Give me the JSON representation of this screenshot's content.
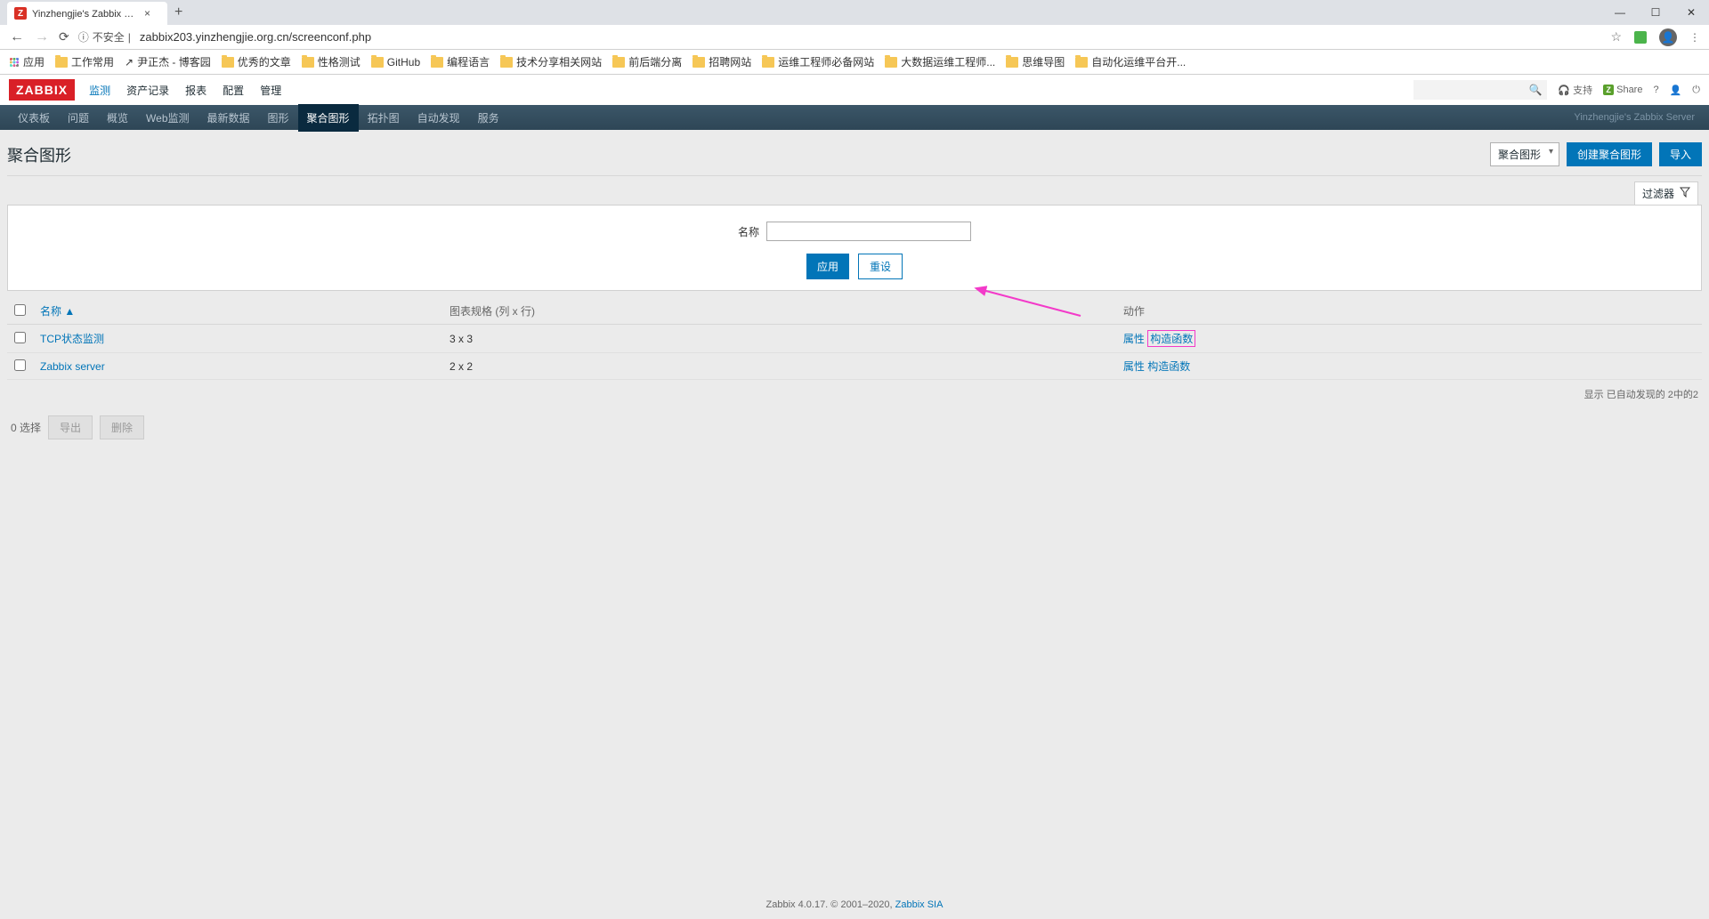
{
  "browser": {
    "tab_title": "Yinzhengjie's Zabbix Server: 聚",
    "favicon_letter": "Z",
    "url_security": "不安全",
    "url": "zabbix203.yinzhengjie.org.cn/screenconf.php"
  },
  "bookmarks": {
    "apps": "应用",
    "items": [
      "工作常用",
      "尹正杰 - 博客园",
      "优秀的文章",
      "性格测试",
      "GitHub",
      "编程语言",
      "技术分享相关网站",
      "前后端分离",
      "招聘网站",
      "运维工程师必备网站",
      "大数据运维工程师...",
      "思维导图",
      "自动化运维平台开..."
    ]
  },
  "zbx_top_menu": [
    "监测",
    "资产记录",
    "报表",
    "配置",
    "管理"
  ],
  "zbx_logo": "ZABBIX",
  "hdr_support": "支持",
  "hdr_share": "Share",
  "submenu": [
    "仪表板",
    "问题",
    "概览",
    "Web监测",
    "最新数据",
    "图形",
    "聚合图形",
    "拓扑图",
    "自动发现",
    "服务"
  ],
  "submenu_right": "Yinzhengjie's Zabbix Server",
  "page_title": "聚合图形",
  "title_select": "聚合图形",
  "btn_create": "创建聚合图形",
  "btn_import": "导入",
  "filter_tab": "过滤器",
  "filter": {
    "name_label": "名称",
    "apply": "应用",
    "reset": "重设"
  },
  "table": {
    "headers": {
      "name": "名称 ▲",
      "dim": "图表规格 (列 x 行)",
      "actions": "动作"
    },
    "rows": [
      {
        "name": "TCP状态监测",
        "dim": "3 x 3",
        "act1": "属性",
        "act2": "构造函数"
      },
      {
        "name": "Zabbix server",
        "dim": "2 x 2",
        "act1": "属性",
        "act2": "构造函数"
      }
    ],
    "footer": "显示 已自动发现的 2中的2"
  },
  "actions": {
    "selected": "0 选择",
    "export": "导出",
    "delete": "删除"
  },
  "footer": {
    "text": "Zabbix 4.0.17. © 2001–2020, ",
    "link": "Zabbix SIA"
  }
}
